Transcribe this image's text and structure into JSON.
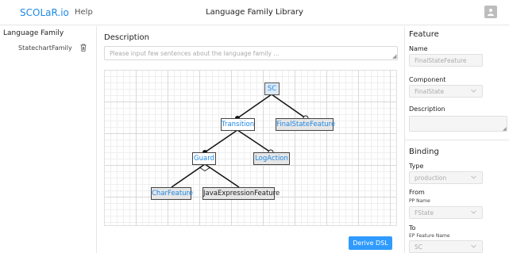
{
  "header": {
    "logo": "SCOLaR.io",
    "help": "Help",
    "title": "Language Family Library"
  },
  "sidebar": {
    "title": "Language Family",
    "items": [
      {
        "label": "StatechartFamily"
      }
    ]
  },
  "main": {
    "description_title": "Description",
    "description_placeholder": "Please input few sentences about the language family ...",
    "nodes": {
      "sc": "SC",
      "transition": "Transition",
      "final_state_feature": "FinalStateFeature",
      "guard": "Guard",
      "log_action": "LogAction",
      "char_feature": "CharFeature",
      "java_expression_feature": "JavaExpressionFeature"
    },
    "derive_button": "Derive DSL"
  },
  "feature_panel": {
    "title": "Feature",
    "name_label": "Name",
    "name_value": "FinalStateFeature",
    "component_label": "Component",
    "component_value": "FinalState",
    "description_label": "Description",
    "description_value": ""
  },
  "binding_panel": {
    "title": "Binding",
    "type_label": "Type",
    "type_value": "production",
    "from_label": "From",
    "pp_name_label": "PP Name",
    "pp_name_value": "FState",
    "to_label": "To",
    "ep_feature_label": "EP Feature Name",
    "ep_feature_value": "SC"
  },
  "colors": {
    "accent": "#1e88e5",
    "button": "#2f9bff",
    "grid": "#d8d8d8"
  }
}
